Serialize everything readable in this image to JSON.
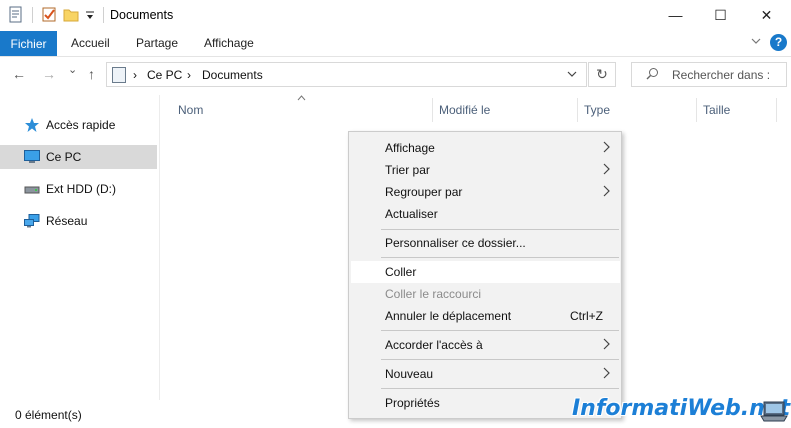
{
  "window": {
    "title": "Documents",
    "minimize_glyph": "—",
    "maximize_glyph": "☐",
    "close_glyph": "✕"
  },
  "ribbon": {
    "file_tab": "Fichier",
    "tabs": [
      "Accueil",
      "Partage",
      "Affichage"
    ],
    "help_glyph": "?"
  },
  "address_bar": {
    "back_glyph": "←",
    "forward_glyph": "→",
    "recent_glyph": "⌄",
    "up_glyph": "↑",
    "breadcrumb": [
      "Ce PC",
      "Documents"
    ],
    "separator": "›",
    "refresh_glyph": "↻"
  },
  "search": {
    "placeholder": "Rechercher dans :"
  },
  "sidebar": {
    "items": [
      {
        "label": "Accès rapide",
        "icon": "star-icon",
        "selected": false
      },
      {
        "label": "Ce PC",
        "icon": "computer-icon",
        "selected": true
      },
      {
        "label": "Ext HDD (D:)",
        "icon": "drive-icon",
        "selected": false
      },
      {
        "label": "Réseau",
        "icon": "network-icon",
        "selected": false
      }
    ]
  },
  "columns": [
    "Nom",
    "Modifié le",
    "Type",
    "Taille"
  ],
  "status_bar": {
    "item_count": "0 élément(s)"
  },
  "context_menu": {
    "items": [
      {
        "label": "Affichage",
        "submenu": true
      },
      {
        "label": "Trier par",
        "submenu": true
      },
      {
        "label": "Regrouper par",
        "submenu": true
      },
      {
        "label": "Actualiser"
      },
      {
        "label": "Personnaliser ce dossier..."
      },
      {
        "label": "Coller",
        "hover": true
      },
      {
        "label": "Coller le raccourci",
        "disabled": true
      },
      {
        "label": "Annuler le déplacement",
        "shortcut": "Ctrl+Z"
      },
      {
        "label": "Accorder l'accès à",
        "submenu": true
      },
      {
        "label": "Nouveau",
        "submenu": true
      },
      {
        "label": "Propriétés"
      }
    ]
  },
  "watermark": {
    "text": "InformatiWeb.net"
  },
  "colors": {
    "accent": "#1979ca",
    "menu_bg": "#f2f2f2",
    "selected_nav": "#d9d9d9",
    "column_header_text": "#4c607a",
    "watermark": "#1c7fd6"
  }
}
